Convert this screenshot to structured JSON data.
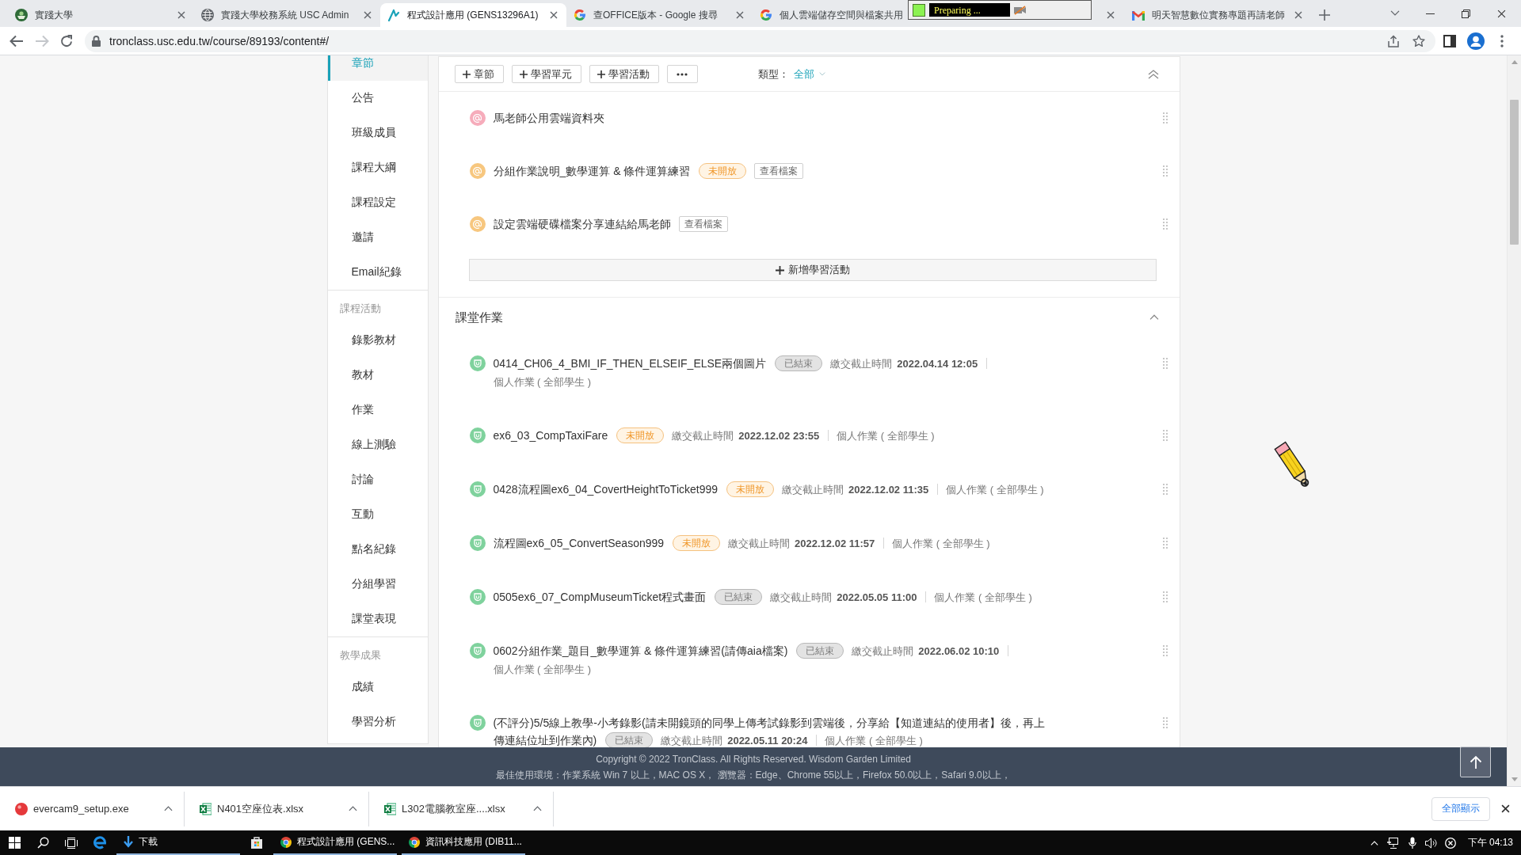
{
  "browser": {
    "tabs": [
      {
        "kind": "school",
        "title": "實踐大學",
        "selected": false,
        "close_button": true
      },
      {
        "kind": "globe",
        "title": "實踐大學校務系統 USC Admin",
        "selected": false,
        "close_button": true
      },
      {
        "kind": "course",
        "title": "程式設計應用 (GENS13296A1)",
        "selected": true,
        "close_button": true
      },
      {
        "kind": "google",
        "title": "查OFFICE版本 - Google 搜尋",
        "selected": false,
        "close_button": true
      },
      {
        "kind": "google",
        "title": "個人雲端儲存空間與檔案共用",
        "selected": false,
        "close_button": false
      },
      {
        "selected": false,
        "close_button": true
      },
      {
        "kind": "mail",
        "title": "明天智慧數位實務專題再請老師",
        "selected": false,
        "close_button": true
      }
    ],
    "forward_disabled": true,
    "address": "tronclass.usc.edu.tw/course/89193/content#/"
  },
  "recorder": {
    "status": "Preparing ..."
  },
  "sidebar": {
    "groups": [
      {
        "items": [
          {
            "label": "章節",
            "selected": true
          },
          {
            "label": "公告",
            "selected": false
          },
          {
            "label": "班級成員",
            "selected": false
          },
          {
            "label": "課程大綱",
            "selected": false
          },
          {
            "label": "課程設定",
            "selected": false
          },
          {
            "label": "邀請",
            "selected": false
          },
          {
            "label": "Email紀錄",
            "selected": false
          }
        ]
      },
      {
        "title": "課程活動",
        "items": [
          {
            "label": "錄影教材",
            "selected": false
          },
          {
            "label": "教材",
            "selected": false
          },
          {
            "label": "作業",
            "selected": false
          },
          {
            "label": "線上測驗",
            "selected": false
          },
          {
            "label": "討論",
            "selected": false
          },
          {
            "label": "互動",
            "selected": false
          },
          {
            "label": "點名紀錄",
            "selected": false
          },
          {
            "label": "分組學習",
            "selected": false
          },
          {
            "label": "課堂表現",
            "selected": false
          }
        ]
      },
      {
        "title": "教學成果",
        "items": [
          {
            "label": "成績",
            "selected": false
          },
          {
            "label": "學習分析",
            "selected": false
          }
        ]
      }
    ]
  },
  "toolbar": {
    "add_buttons": [
      "章節",
      "學習單元",
      "學習活動"
    ],
    "filter_label": "類型：",
    "filter_value": "全部"
  },
  "chapter": {
    "activities": [
      {
        "title": "馬老師公用雲端資料夾",
        "color": "#f6acbb"
      },
      {
        "title": "分組作業說明_數學運算 & 條件運算練習",
        "color": "#f7c77f",
        "badge": {
          "text": "未開放",
          "kind": "upcoming"
        },
        "action": "查看檔案"
      },
      {
        "title": "設定雲端硬碟檔案分享連結給馬老師",
        "color": "#f7c77f",
        "action": "查看檔案"
      }
    ],
    "add_button": "新增學習活動"
  },
  "homework": {
    "title": "課堂作業",
    "expanded": true,
    "assignments": [
      {
        "title": "0414_CH06_4_BMI_IF_THEN_ELSEIF_ELSE兩個圖片",
        "badge": {
          "text": "已結束",
          "kind": "ended"
        },
        "deadline_label": "繳交截止時間",
        "deadline": "2022.04.14 12:05",
        "type": "個人作業 ( 全部學生 )"
      },
      {
        "title": "ex6_03_CompTaxiFare",
        "badge": {
          "text": "未開放",
          "kind": "upcoming"
        },
        "deadline_label": "繳交截止時間",
        "deadline": "2022.12.02 23:55",
        "type": "個人作業 ( 全部學生 )"
      },
      {
        "title": "0428流程圖ex6_04_CovertHeightToTicket999",
        "badge": {
          "text": "未開放",
          "kind": "upcoming"
        },
        "deadline_label": "繳交截止時間",
        "deadline": "2022.12.02 11:35",
        "type": "個人作業 ( 全部學生 )"
      },
      {
        "title": "流程圖ex6_05_ConvertSeason999",
        "badge": {
          "text": "未開放",
          "kind": "upcoming"
        },
        "deadline_label": "繳交截止時間",
        "deadline": "2022.12.02 11:57",
        "type": "個人作業 ( 全部學生 )"
      },
      {
        "title": "0505ex6_07_CompMuseumTicket程式畫面",
        "badge": {
          "text": "已結束",
          "kind": "ended"
        },
        "deadline_label": "繳交截止時間",
        "deadline": "2022.05.05 11:00",
        "type": "個人作業 ( 全部學生 )"
      },
      {
        "title": "0602分組作業_題目_數學運算 & 條件運算練習(請傳aia檔案)",
        "badge": {
          "text": "已結束",
          "kind": "ended"
        },
        "deadline_label": "繳交截止時間",
        "deadline": "2022.06.02 10:10",
        "type": "個人作業 ( 全部學生 )"
      },
      {
        "title": "(不評分)5/5線上教學-小考錄影(請未開鏡頭的同學上傳考試錄影到雲端後，分享給【知道連結的使用者】後，再上",
        "title_continued": "傳連結位址到作業內)",
        "badge": {
          "text": "已結束",
          "kind": "ended"
        },
        "deadline_label": "繳交截止時間",
        "deadline": "2022.05.11 20:24",
        "type": "個人作業 ( 全部學生 )"
      }
    ]
  },
  "footer": {
    "copyright": "Copyright © 2022 TronClass. All Rights Reserved. Wisdom Garden Limited",
    "environment": "最佳使用環境：作業系統 Win 7 以上，MAC OS X， 瀏覽器：Edge、Chrome 55以上，Firefox 50.0以上，Safari 9.0以上，"
  },
  "downloads": {
    "items": [
      {
        "kind": "installer",
        "name": "evercam9_setup.exe"
      },
      {
        "kind": "spreadsheet",
        "name": "N401空座位表.xlsx"
      },
      {
        "kind": "spreadsheet",
        "name": "L302電腦教室座....xlsx"
      }
    ],
    "show_all": "全部顯示"
  },
  "taskbar": {
    "apps": [
      {
        "kind": "edge",
        "active": false
      },
      {
        "kind": "downloads",
        "label": "下載",
        "active": true
      },
      {
        "kind": "store",
        "active": false
      },
      {
        "kind": "chrome",
        "label": "程式設計應用 (GENS...",
        "active": true
      },
      {
        "kind": "chrome",
        "label": "資訊科技應用 (DIB11...",
        "active": true
      }
    ],
    "clock": "下午 04:13"
  }
}
